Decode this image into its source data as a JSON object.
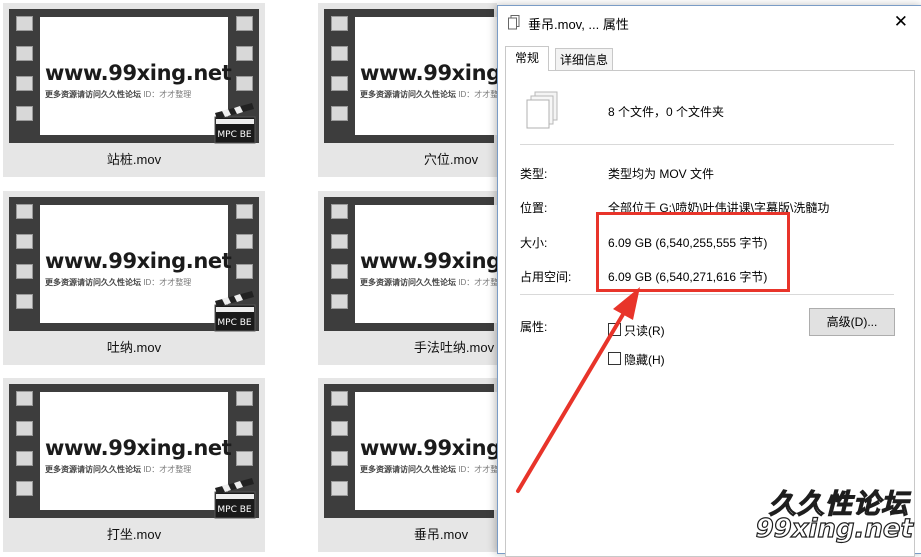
{
  "tiles_left": [
    {
      "caption": "站桩.mov"
    },
    {
      "caption": "吐纳.mov"
    },
    {
      "caption": "打坐.mov"
    }
  ],
  "tiles_right": [
    {
      "caption": "穴位.mov"
    },
    {
      "caption": "手法吐纳.mov"
    },
    {
      "caption": "垂吊.mov"
    }
  ],
  "thumbnail": {
    "watermark_url": "www.99xing.net",
    "watermark_sub": "更多资源请访问久久性论坛",
    "watermark_id": "ID：才才整理",
    "badge_text": "MPC BE"
  },
  "dialog": {
    "title": "垂吊.mov, ... 属性",
    "close_symbol": "✕",
    "tabs": [
      "常规",
      "详细信息"
    ],
    "file_count": "8 个文件，0 个文件夹",
    "rows": [
      {
        "label": "类型:",
        "value": "类型均为 MOV 文件"
      },
      {
        "label": "位置:",
        "value": "全部位于 G:\\喷奶\\叶伟讲课\\字幕版\\洗髓功"
      },
      {
        "label": "大小:",
        "value": "6.09 GB (6,540,255,555 字节)"
      },
      {
        "label": "占用空间:",
        "value": "6.09 GB (6,540,271,616 字节)"
      }
    ],
    "attributes_label": "属性:",
    "readonly_label": "只读(R)",
    "hidden_label": "隐藏(H)",
    "advanced_button": "高级(D)..."
  },
  "logo": {
    "line1": "久久性论坛",
    "line2": "99xing.net"
  },
  "colors": {
    "annotation_red": "#e8342a",
    "dialog_border": "#7a9cc6"
  }
}
